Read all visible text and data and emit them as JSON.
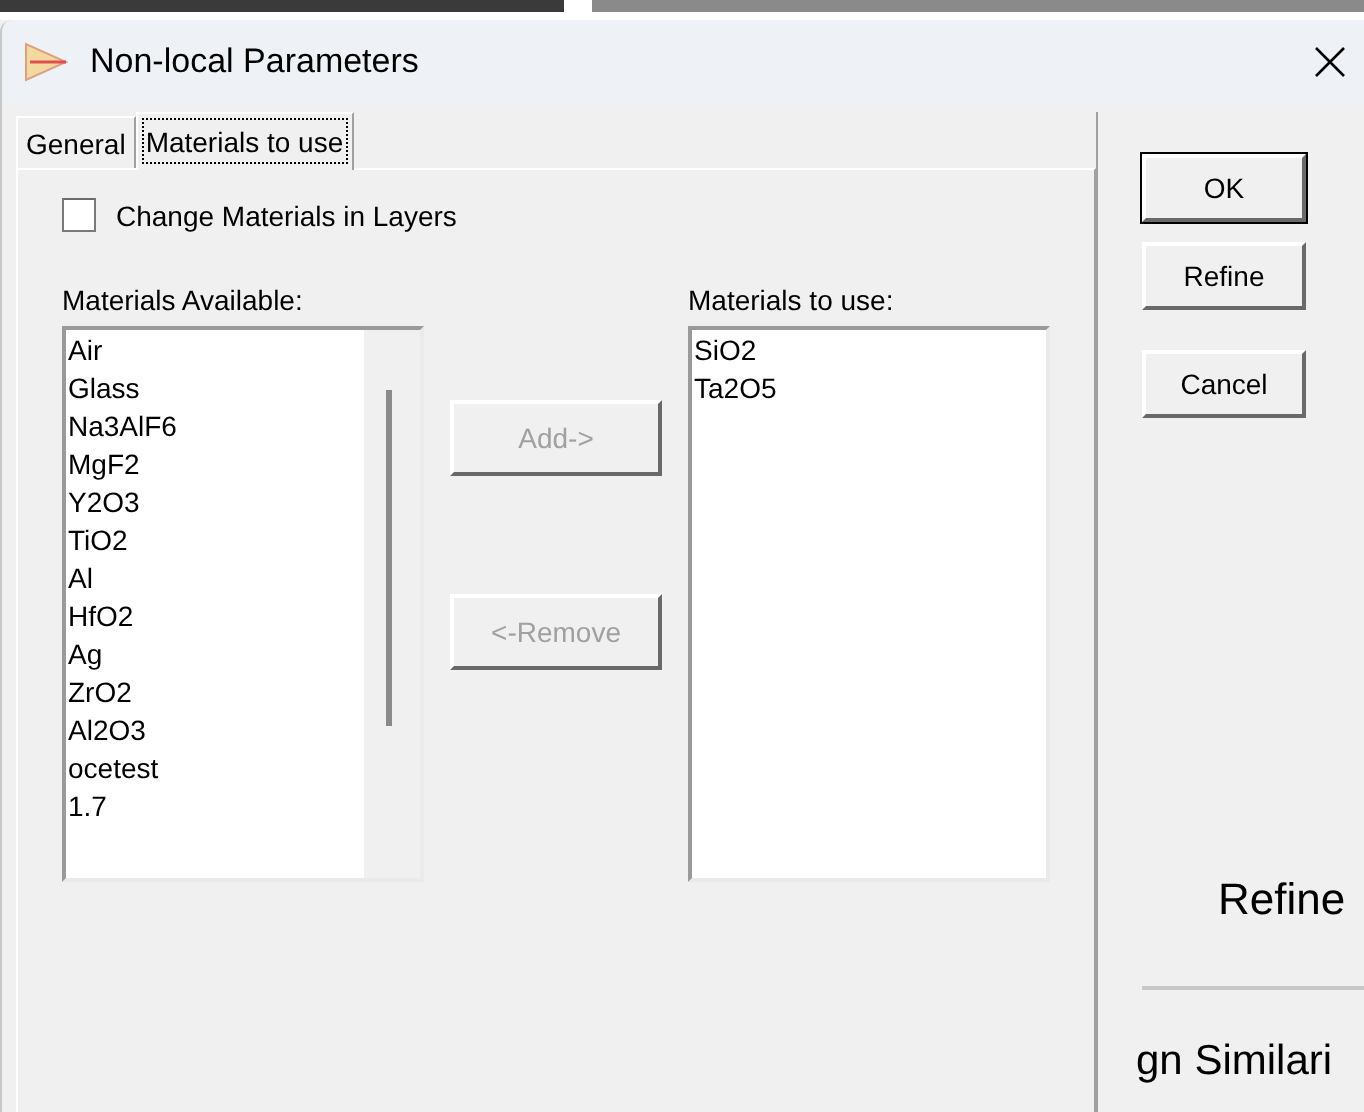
{
  "window": {
    "title": "Non-local Parameters"
  },
  "tabs": [
    {
      "label": "General",
      "selected": false
    },
    {
      "label": "Materials to use",
      "selected": true
    }
  ],
  "change_materials": {
    "label": "Change Materials in Layers",
    "checked": false
  },
  "materials_available": {
    "label": "Materials Available:",
    "items": [
      "Air",
      "Glass",
      "Na3AlF6",
      "MgF2",
      "Y2O3",
      "TiO2",
      "Al",
      "HfO2",
      "Ag",
      "ZrO2",
      "Al2O3",
      "ocetest",
      "1.7"
    ]
  },
  "transfer_buttons": [
    {
      "label": "Add->",
      "disabled": true
    },
    {
      "label": "<-Remove",
      "disabled": true
    }
  ],
  "materials_to_use": {
    "label": "Materials to use:",
    "items": [
      "SiO2",
      "Ta2O5"
    ]
  },
  "buttons": [
    {
      "label": "OK",
      "default": true
    },
    {
      "label": "Refine",
      "default": false
    },
    {
      "label": "Cancel",
      "default": false
    }
  ],
  "background_window": {
    "heading": "Refine",
    "text": "gn Similari"
  }
}
